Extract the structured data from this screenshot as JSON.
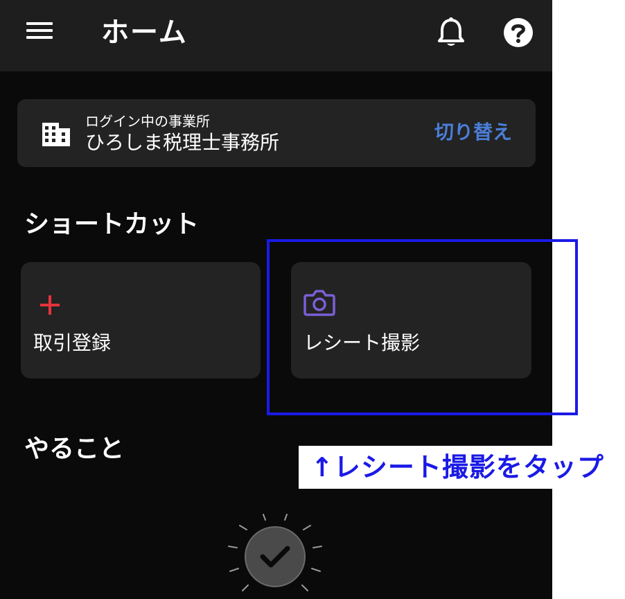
{
  "app_bar": {
    "title": "ホーム",
    "menu_icon": "hamburger-menu-icon",
    "bell_icon": "bell-icon",
    "help_icon": "help-circle-icon"
  },
  "office": {
    "caption": "ログイン中の事業所",
    "name": "ひろしま税理士事務所",
    "switch_label": "切り替え",
    "icon": "building-icon"
  },
  "shortcuts": {
    "title": "ショートカット",
    "items": [
      {
        "label": "取引登録",
        "icon": "plus-icon",
        "icon_color": "#e5333a"
      },
      {
        "label": "レシート撮影",
        "icon": "camera-icon",
        "icon_color": "#7b5fd6"
      }
    ]
  },
  "todo": {
    "title": "やること",
    "icon": "checkmark-circle-icon"
  },
  "annotation": {
    "text": "↑レシート撮影をタップ",
    "color": "#1a1ae6"
  },
  "colors": {
    "accent_link": "#4a7ed8",
    "background": "#0a0a0a",
    "card": "#232323",
    "app_bar": "#1e1e1e"
  }
}
